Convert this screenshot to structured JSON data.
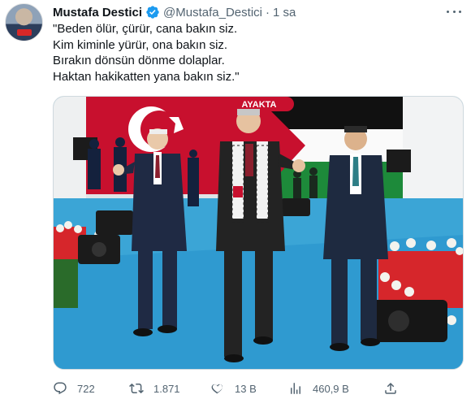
{
  "author": {
    "name": "Mustafa Destici",
    "handle": "@Mustafa_Destici",
    "separator": "·",
    "time": "1 sa",
    "verified_color": "#1d9bf0"
  },
  "tweet": {
    "lines": [
      "\"Beden ölür, çürür, cana bakın siz.",
      "Kim kiminle yürür, ona bakın siz.",
      "Bırakın dönsün dönme dolaplar.",
      "Haktan hakikatten yana bakın siz.\""
    ]
  },
  "media": {
    "banner_text": "AYAKTA"
  },
  "actions": {
    "replies": "722",
    "retweets": "1.871",
    "likes": "13 B",
    "views": "460,9 B"
  },
  "icons": {
    "verified": "verified-badge-icon",
    "more": "more-dots-icon",
    "reply": "reply-icon",
    "retweet": "retweet-icon",
    "like": "heart-icon",
    "views": "views-bar-chart-icon",
    "share": "share-icon"
  },
  "colors": {
    "text": "#0f1419",
    "muted": "#536471",
    "accent": "#1d9bf0"
  }
}
